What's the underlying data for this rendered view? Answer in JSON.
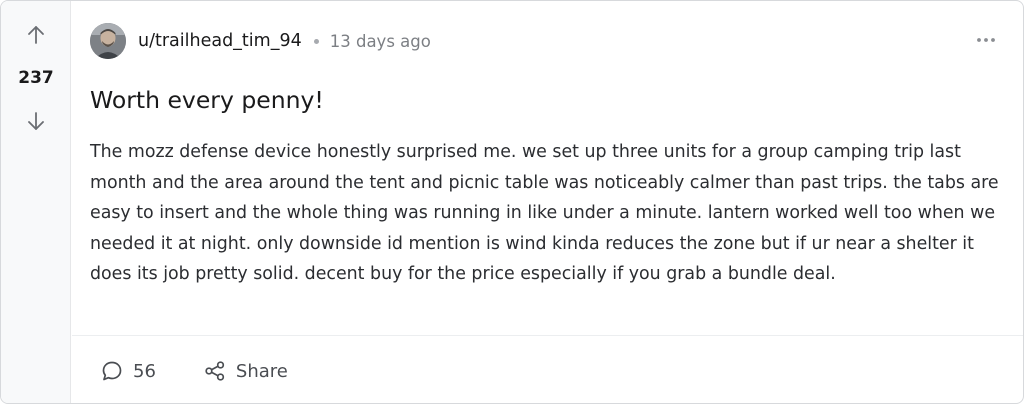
{
  "vote": {
    "count": "237",
    "upvote_icon": "arrow-up-icon",
    "downvote_icon": "arrow-down-icon"
  },
  "post": {
    "author": "u/trailhead_tim_94",
    "separator": "•",
    "timestamp": "13 days ago",
    "title": "Worth every penny!",
    "body": "The mozz defense device honestly surprised me. we set up three units for a group camping trip last month and the area around the tent and picnic table was noticeably calmer than past trips. the tabs are easy to insert and the whole thing was running in like under a minute. lantern worked well too when we needed it at night. only downside id mention is wind kinda reduces the zone but if ur near a shelter it does its job pretty solid. decent buy for the price especially if you grab a bundle deal."
  },
  "actions": {
    "comments_count": "56",
    "share_label": "Share"
  },
  "colors": {
    "border": "#d7d9dc",
    "rail_bg": "#f8f9fa",
    "text": "#1a1a1b",
    "muted": "#7c7f84"
  }
}
